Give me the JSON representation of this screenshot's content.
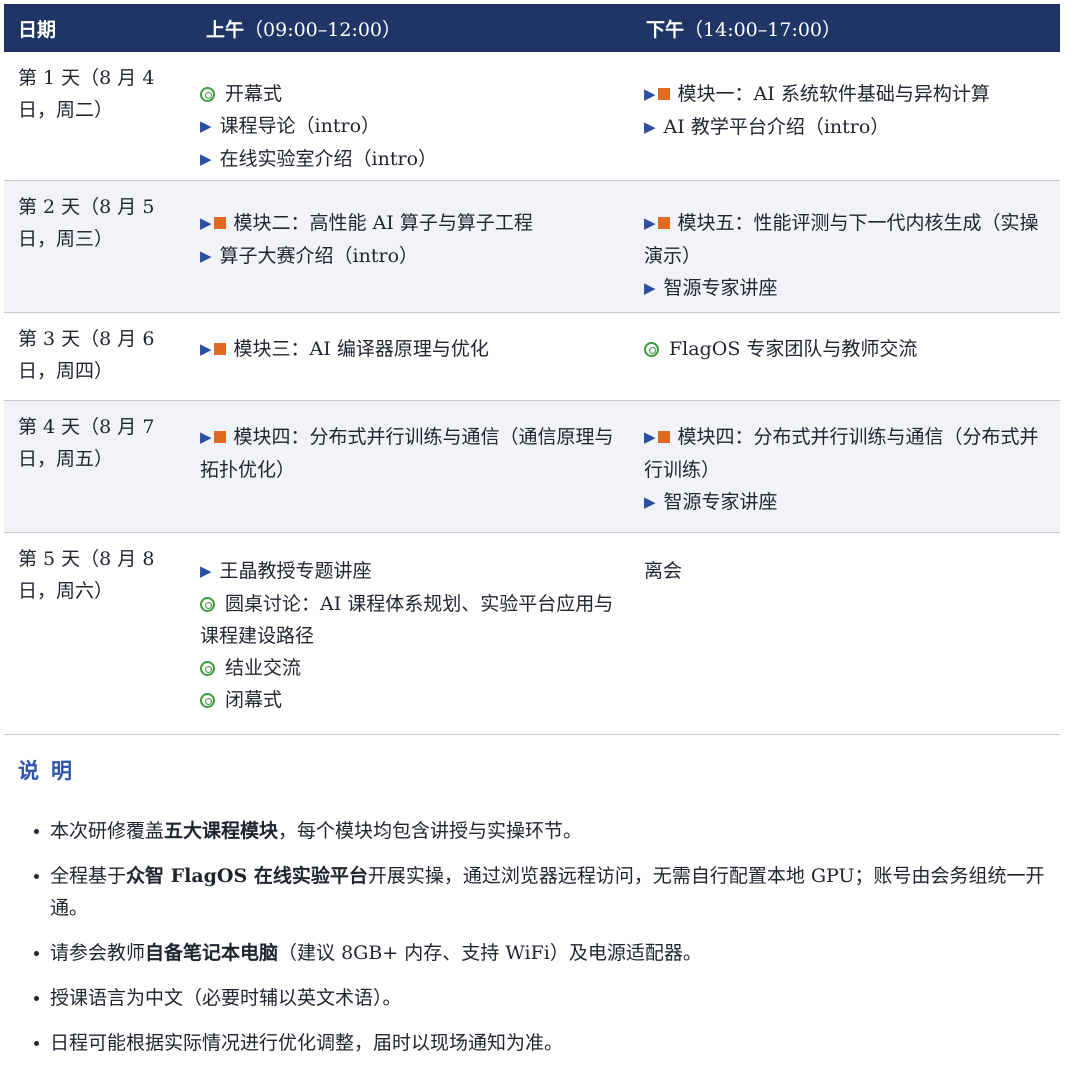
{
  "table": {
    "headers": {
      "day": "日期",
      "am": "上午",
      "am_time": "（09:00–12:00）",
      "pm": "下午",
      "pm_time": "（14:00–17:00）"
    },
    "rows": [
      {
        "day": "第 1 天（8 月 4 日，周二）",
        "am": [
          {
            "icon": "ring",
            "text": "开幕式"
          },
          {
            "icon": "triangle",
            "text": "课程导论（intro）"
          },
          {
            "icon": "triangle",
            "text": "在线实验室介绍（intro）"
          }
        ],
        "pm": [
          {
            "icon": "triangle-square",
            "text": "模块一：AI 系统软件基础与异构计算"
          },
          {
            "icon": "triangle",
            "text": "AI 教学平台介绍（intro）"
          }
        ]
      },
      {
        "day": "第 2 天（8 月 5 日，周三）",
        "am": [
          {
            "icon": "triangle-square",
            "text": "模块二：高性能 AI 算子与算子工程"
          },
          {
            "icon": "triangle",
            "text": "算子大赛介绍（intro）"
          }
        ],
        "pm": [
          {
            "icon": "triangle-square",
            "text": "模块五：性能评测与下一代内核生成（实操演示）"
          },
          {
            "icon": "triangle",
            "text": "智源专家讲座"
          }
        ]
      },
      {
        "day": "第 3 天（8 月 6 日，周四）",
        "am": [
          {
            "icon": "triangle-square",
            "text": "模块三：AI 编译器原理与优化"
          }
        ],
        "pm": [
          {
            "icon": "ring",
            "text": "FlagOS 专家团队与教师交流"
          }
        ]
      },
      {
        "day": "第 4 天（8 月 7 日，周五）",
        "am": [
          {
            "icon": "triangle-square",
            "text": "模块四：分布式并行训练与通信（通信原理与拓扑优化）"
          }
        ],
        "pm": [
          {
            "icon": "triangle-square",
            "text": "模块四：分布式并行训练与通信（分布式并行训练）"
          },
          {
            "icon": "triangle",
            "text": "智源专家讲座"
          }
        ]
      },
      {
        "day": "第 5 天（8 月 8 日，周六）",
        "am": [
          {
            "icon": "triangle",
            "text": "王晶教授专题讲座"
          },
          {
            "icon": "ring",
            "text": "圆桌讨论：AI 课程体系规划、实验平台应用与课程建设路径"
          },
          {
            "icon": "ring",
            "text": "结业交流"
          },
          {
            "icon": "ring",
            "text": "闭幕式"
          }
        ],
        "pm": [
          {
            "icon": "none",
            "text": "离会"
          }
        ]
      }
    ]
  },
  "notes": {
    "title": "说明",
    "items": [
      {
        "before": "本次研修覆盖",
        "bold": "五大课程模块",
        "after": "，每个模块均包含讲授与实操环节。"
      },
      {
        "before": "全程基于",
        "bold": "众智 FlagOS 在线实验平台",
        "after": "开展实操，通过浏览器远程访问，无需自行配置本地 GPU；账号由会务组统一开通。"
      },
      {
        "before": "请参会教师",
        "bold": "自备笔记本电脑",
        "after": "（建议 8GB+ 内存、支持 WiFi）及电源适配器。"
      },
      {
        "before": "授课语言为中文（必要时辅以英文术语）。",
        "bold": "",
        "after": ""
      },
      {
        "before": "日程可能根据实际情况进行优化调整，届时以现场通知为准。",
        "bold": "",
        "after": ""
      }
    ]
  },
  "colors": {
    "header_bg": "#1f3566",
    "triangle": "#2a4fa1",
    "square": "#e06a21",
    "ring": "#3d9a3d",
    "notes_title": "#2d54a8",
    "alt_row_bg": "#f1f3f7"
  }
}
